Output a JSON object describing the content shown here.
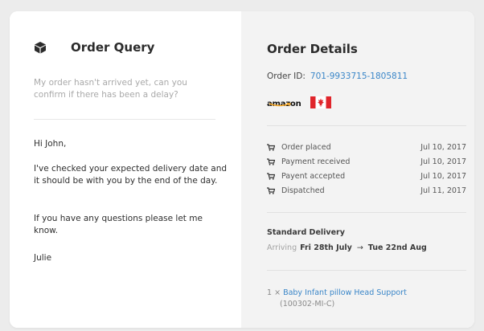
{
  "left": {
    "title": "Order Query",
    "icon": "cube-icon",
    "query": "My order hasn't arrived yet, can you confirm if there has been a delay?",
    "message": {
      "greeting": "Hi John,",
      "para1": "I've checked your expected delivery date and it should be with you by the end of the day.",
      "para2": "If you have any questions please let me know.",
      "signoff": "Julie"
    }
  },
  "right": {
    "title": "Order Details",
    "order_id_label": "Order ID:",
    "order_id": "701-9933715-1805811",
    "brand_logo_text": "amazon",
    "flag": "canada-flag",
    "timeline": [
      {
        "label": "Order placed",
        "date": "Jul 10, 2017"
      },
      {
        "label": "Payment received",
        "date": "Jul 10, 2017"
      },
      {
        "label": "Payent accepted",
        "date": "Jul 10, 2017"
      },
      {
        "label": "Dispatched",
        "date": "Jul 11, 2017"
      }
    ],
    "delivery": {
      "type": "Standard Delivery",
      "arriving_label": "Arriving",
      "from": "Fri 28th July",
      "arrow": "→",
      "to": "Tue 22nd Aug"
    },
    "item": {
      "qty": "1 ×",
      "name": "Baby Infant pillow Head Support",
      "sku": "(100302-MI-C)"
    }
  },
  "colors": {
    "link": "#3a86c8",
    "right_panel_bg": "#f3f3f3",
    "muted_text": "#a9a9a9"
  }
}
